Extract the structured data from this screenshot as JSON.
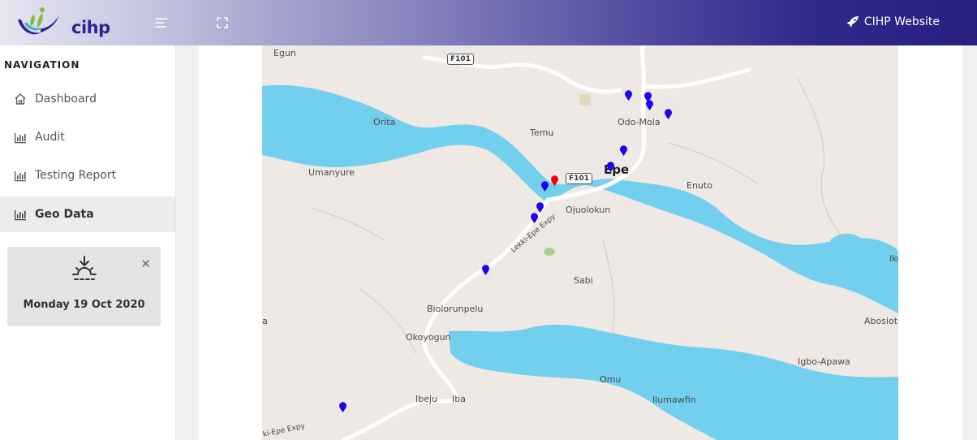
{
  "header": {
    "logo_text": "cihp",
    "site_link": "CIHP Website",
    "colors": {
      "gradient_start": "#e6e6f2",
      "gradient_end": "#261f80"
    }
  },
  "sidebar": {
    "title": "NAVIGATION",
    "items": [
      {
        "label": "Dashboard",
        "icon": "home-icon"
      },
      {
        "label": "Audit",
        "icon": "bar-chart-icon"
      },
      {
        "label": "Testing Report",
        "icon": "bar-chart-icon"
      },
      {
        "label": "Geo Data",
        "icon": "bar-chart-icon",
        "active": true
      }
    ]
  },
  "widget": {
    "icon": "sunrise-icon",
    "date": "Monday 19 Oct 2020"
  },
  "map": {
    "places": [
      "Egun",
      "Orita",
      "Temu",
      "Odo-Mola",
      "Umanyure",
      "Epe",
      "Enuto",
      "Ojuolokun",
      "Sabi",
      "Biolorunpelu",
      "Okoyogun",
      "Omu",
      "Ilumawfin",
      "Igbo-Apawa",
      "Abosioto",
      "Ibeju",
      "Iba",
      "Iko",
      "a"
    ],
    "roads": [
      "F101",
      "F101",
      "Lekki-Epe Expy",
      "ki-Epe Expy"
    ],
    "markers": {
      "blue_count": 12,
      "red_count": 1
    },
    "colors": {
      "water": "#72cfee",
      "land": "#eee9e4",
      "marker_blue": "#1a00f5",
      "marker_red": "#f50000"
    }
  }
}
